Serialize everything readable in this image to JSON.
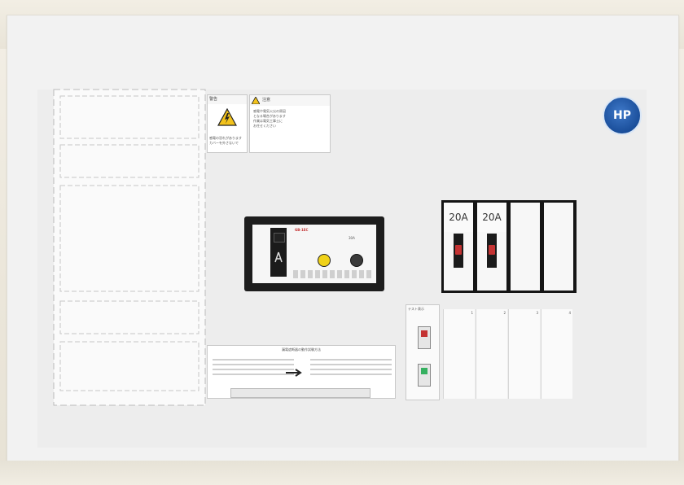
{
  "warning_labels": [
    {
      "header": "警告",
      "text": [
        "感電の恐れがあります",
        "カバーを外さないで"
      ]
    },
    {
      "header": "注意",
      "text": [
        "感電や電気火災の原因",
        "となる場合があります",
        "作業は電気工事士に",
        "お任せください"
      ]
    }
  ],
  "leakage_breaker": {
    "model": "GB-1EC",
    "rating": "30A"
  },
  "breakers": [
    {
      "rating": "20A",
      "toggle_color": "#c43333"
    },
    {
      "rating": "20A",
      "toggle_color": "#c43333"
    }
  ],
  "mini_panel": {
    "label": "テスト表示",
    "numbers": [
      "1",
      "2",
      "3",
      "4"
    ]
  },
  "bottom_label": {
    "title": "漏電遮断器の動作試験方法"
  },
  "logo": {
    "text": "HP"
  },
  "colors": {
    "panel": "#ededed",
    "breaker_body": "#f7f7f7",
    "logo_blue": "#1a4e9a"
  }
}
